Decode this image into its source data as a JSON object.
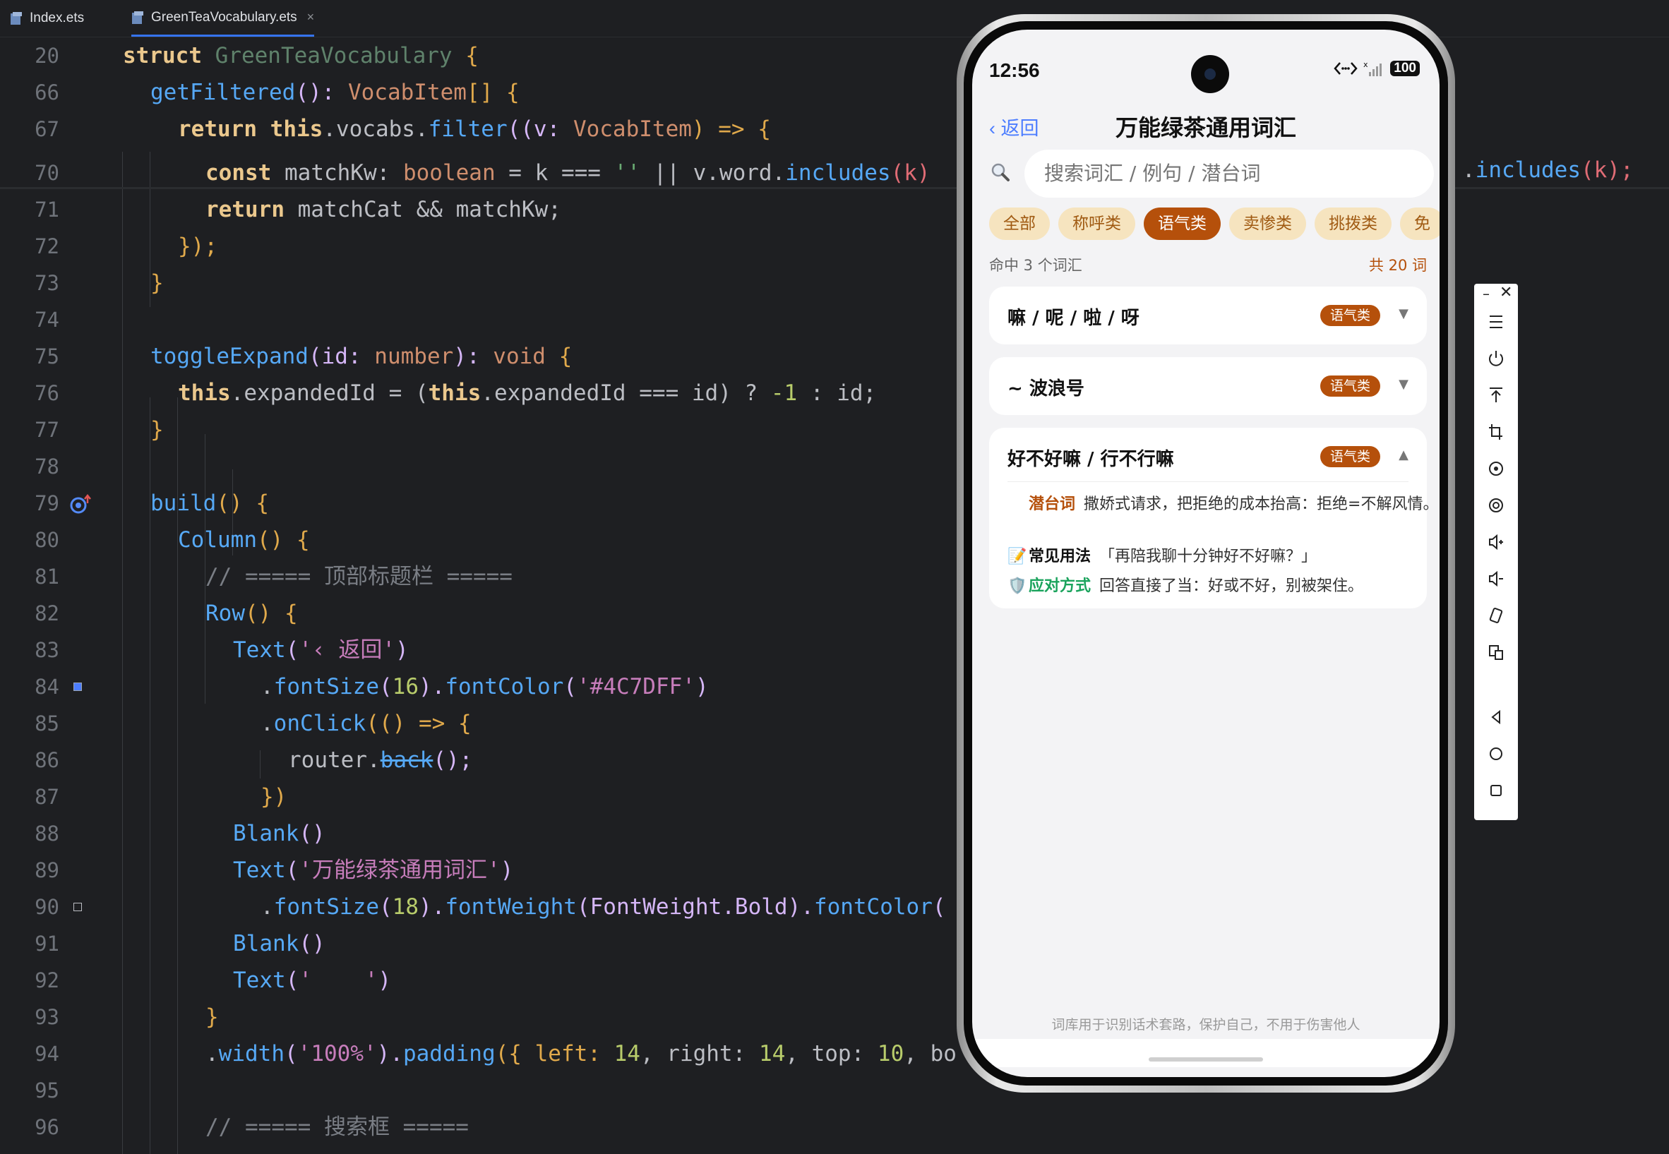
{
  "ide": {
    "tabs": [
      {
        "label": "Index.ets"
      },
      {
        "label": "GreenTeaVocabulary.ets"
      }
    ],
    "close_glyph": "×",
    "lines": [
      {
        "n": "20"
      },
      {
        "n": "66"
      },
      {
        "n": "67"
      },
      {
        "n": "70"
      },
      {
        "n": "71"
      },
      {
        "n": "72"
      },
      {
        "n": "73"
      },
      {
        "n": "74"
      },
      {
        "n": "75"
      },
      {
        "n": "76"
      },
      {
        "n": "77"
      },
      {
        "n": "78"
      },
      {
        "n": "79"
      },
      {
        "n": "80"
      },
      {
        "n": "81"
      },
      {
        "n": "82"
      },
      {
        "n": "83"
      },
      {
        "n": "84"
      },
      {
        "n": "85"
      },
      {
        "n": "86"
      },
      {
        "n": "87"
      },
      {
        "n": "88"
      },
      {
        "n": "89"
      },
      {
        "n": "90"
      },
      {
        "n": "91"
      },
      {
        "n": "92"
      },
      {
        "n": "93"
      },
      {
        "n": "94"
      },
      {
        "n": "95"
      },
      {
        "n": "96"
      }
    ],
    "code": {
      "l20": [
        "struct",
        "GreenTeaVocabulary",
        "{"
      ],
      "l66": [
        "getFiltered",
        "(): ",
        "VocabItem",
        "[] {"
      ],
      "l67": [
        "return",
        "this",
        ".vocabs.",
        "filter",
        "((v: ",
        "VocabItem",
        ") => {"
      ],
      "l70": [
        "const",
        " matchKw: ",
        "boolean",
        " = k === ",
        "''",
        " || v.word.",
        "includes",
        "(k)"
      ],
      "l71": [
        "return",
        " matchCat && matchKw;"
      ],
      "l72": [
        "});"
      ],
      "l73": [
        "}"
      ],
      "l75": [
        "toggleExpand",
        "(id: ",
        "number",
        "): ",
        "void",
        " {"
      ],
      "l76": [
        "this",
        ".expandedId = (",
        "this",
        ".expandedId === id) ? ",
        "-1",
        " : id;"
      ],
      "l77": [
        "}"
      ],
      "l79": [
        "build",
        "() {"
      ],
      "l80": [
        "Column",
        "() {"
      ],
      "l81": [
        "// ===== 顶部标题栏 ====="
      ],
      "l82": [
        "Row",
        "() {"
      ],
      "l83": [
        "Text",
        "(",
        "'‹ 返回'",
        ")"
      ],
      "l84": [
        ".",
        "fontSize",
        "(",
        "16",
        ").",
        "fontColor",
        "(",
        "'#4C7DFF'",
        ")"
      ],
      "l85": [
        ".",
        "onClick",
        "(() => {"
      ],
      "l86": [
        "router.",
        "back",
        "();"
      ],
      "l87": [
        "})"
      ],
      "l88": [
        "Blank",
        "()"
      ],
      "l89": [
        "Text",
        "(",
        "'万能绿茶通用词汇'",
        ")"
      ],
      "l90": [
        ".",
        "fontSize",
        "(",
        "18",
        ").",
        "fontWeight",
        "(FontWeight.Bold).",
        "fontColor",
        "("
      ],
      "l91": [
        "Blank",
        "()"
      ],
      "l92": [
        "Text",
        "(",
        "'    '",
        ")"
      ],
      "l93": [
        "}"
      ],
      "l94": [
        ".",
        "width",
        "(",
        "'100%'",
        ").",
        "padding",
        "({ left: ",
        "14",
        ", right: ",
        "14",
        ", top: ",
        "10",
        ", bo"
      ],
      "l96": [
        "// ===== 搜索框 ====="
      ]
    },
    "overflow": [
      ".",
      "includes",
      "(k);"
    ]
  },
  "phone": {
    "status": {
      "time": "12:56",
      "battery": "100"
    },
    "nav": {
      "back": "‹ 返回",
      "title": "万能绿茶通用词汇"
    },
    "search": {
      "placeholder": "搜索词汇 / 例句 / 潜台词"
    },
    "chips": [
      {
        "label": "全部",
        "active": false
      },
      {
        "label": "称呼类",
        "active": false
      },
      {
        "label": "语气类",
        "active": true
      },
      {
        "label": "卖惨类",
        "active": false
      },
      {
        "label": "挑拨类",
        "active": false
      },
      {
        "label": "免",
        "active": false
      }
    ],
    "hit_count": "命中 3 个词汇",
    "total_count": "共 20 词",
    "cards": [
      {
        "title": "嘛 / 呢 / 啦 / 呀",
        "tag": "语气类",
        "arrow": "▼"
      },
      {
        "title": "~ 波浪号",
        "tag": "语气类",
        "arrow": "▼"
      },
      {
        "title": "好不好嘛 / 行不行嘛",
        "tag": "语气类",
        "arrow": "▲",
        "details": [
          {
            "icon": "speech-bubble-icon",
            "emoji": "💬",
            "label": "潜台词",
            "color": "#b5500b",
            "text": "撒娇式请求，把拒绝的成本抬高：拒绝=不解风情。"
          },
          {
            "icon": "memo-icon",
            "emoji": "📝",
            "label": "常见用法",
            "color": "#111111",
            "text": "「再陪我聊十分钟好不好嘛？」"
          },
          {
            "icon": "shield-icon",
            "emoji": "🛡️",
            "label": "应对方式",
            "color": "#1aa35c",
            "text": "回答直接了当：好或不好，别被架住。"
          }
        ]
      }
    ],
    "footer": "词库用于识别话术套路，保护自己，不用于伤害他人"
  },
  "emulator": {
    "buttons": [
      "menu-icon",
      "power-icon",
      "pin-top-icon",
      "crop-icon",
      "rotate-icon",
      "screenshot-icon",
      "volume-up-icon",
      "volume-down-icon",
      "shake-icon",
      "multi-device-icon",
      "back-nav-icon",
      "home-nav-icon",
      "recents-icon"
    ]
  },
  "colors": {
    "accent": "#4c7dff",
    "brand": "#b5500b",
    "chip_bg": "#f6e4bf"
  }
}
